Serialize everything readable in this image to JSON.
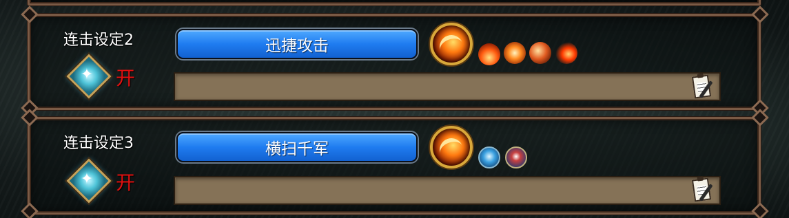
{
  "combo_sets": [
    {
      "title": "连击设定2",
      "toggle_icon": "diamond-gem-icon",
      "status": "开",
      "skill_name": "迅捷攻击",
      "main_skill_icon": "fire-slash-icon",
      "sub_skill_icons": [
        "flame-pillar-icon",
        "fire-burst-icon",
        "fire-blade-icon",
        "fire-crescent-icon"
      ],
      "edit_icon": "clipboard-pen-icon"
    },
    {
      "title": "连击设定3",
      "toggle_icon": "diamond-gem-icon",
      "status": "开",
      "skill_name": "横扫千军",
      "main_skill_icon": "fire-sweep-icon",
      "sub_skill_icons": [
        "blue-wing-emblem-icon",
        "shield-emblem-icon"
      ],
      "edit_icon": "clipboard-pen-icon"
    }
  ],
  "colors": {
    "status_on": "#e01010",
    "skill_button": "#1f7cf0",
    "frame": "#7a5a45",
    "input_bar": "#857257"
  }
}
